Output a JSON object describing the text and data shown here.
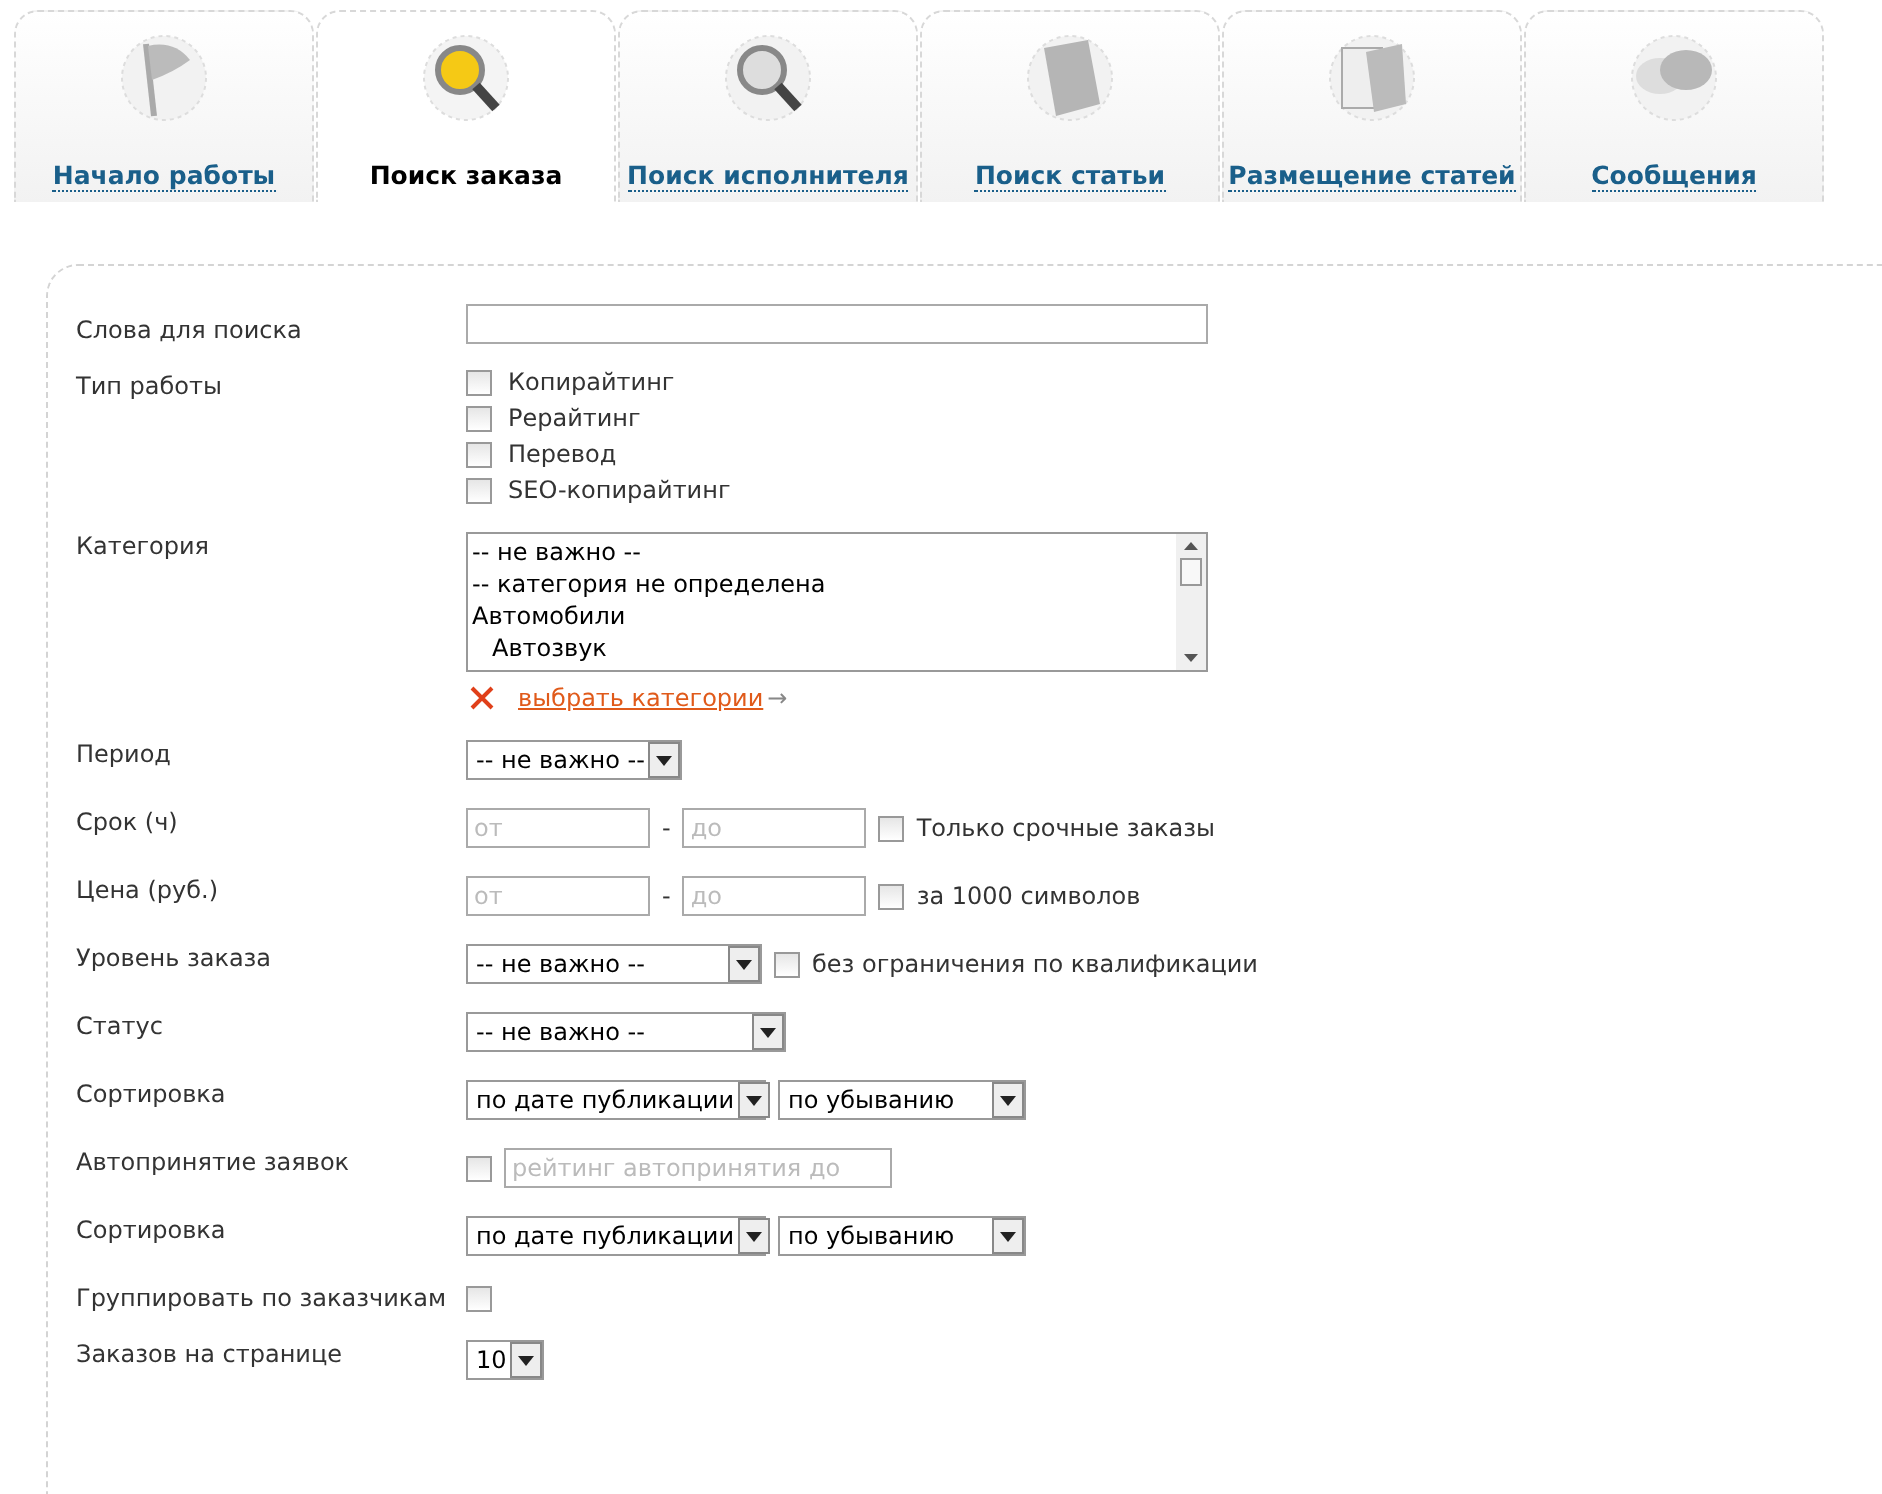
{
  "tabs": [
    {
      "label": "Начало работы",
      "selected": false
    },
    {
      "label": "Поиск заказа",
      "selected": true
    },
    {
      "label": "Поиск исполнителя",
      "selected": false
    },
    {
      "label": "Поиск статьи",
      "selected": false
    },
    {
      "label": "Размещение статей",
      "selected": false
    },
    {
      "label": "Сообщения",
      "selected": false
    }
  ],
  "form": {
    "rows": [
      {
        "kind": "text",
        "label": "Слова для поиска"
      },
      {
        "kind": "checkboxes",
        "label": "Тип работы",
        "options": [
          {
            "label": "Копирайтинг",
            "checked": false
          },
          {
            "label": "Рерайтинг",
            "checked": false
          },
          {
            "label": "Перевод",
            "checked": false
          },
          {
            "label": "SEO-копирайтинг",
            "checked": false
          }
        ]
      },
      {
        "kind": "listbox",
        "label": "Категория",
        "items": [
          {
            "label": "-- не важно --"
          },
          {
            "label": "-- категория не определена"
          },
          {
            "label": "Автомобили",
            "children": [
              {
                "label": "Автозвук"
              }
            ]
          }
        ],
        "link": "выбрать категории",
        "arrow": "→"
      },
      {
        "kind": "select",
        "label": "Период",
        "value": "-- не важно --"
      },
      {
        "kind": "range",
        "label": "Срок (ч)",
        "from": {
          "placeholder": "от"
        },
        "dash": "-",
        "to": {
          "placeholder": "до"
        },
        "check": {
          "label": "Только срочные заказы",
          "checked": false
        }
      },
      {
        "kind": "range",
        "label": "Цена (руб.)",
        "from": {
          "placeholder": "от"
        },
        "dash": "-",
        "to": {
          "placeholder": "до"
        },
        "check": {
          "label": "за 1000 символов",
          "checked": false
        }
      },
      {
        "kind": "select-check",
        "label": "Уровень заказа",
        "value": "-- не важно --",
        "check": {
          "label": "без ограничения по квалификации",
          "checked": false
        }
      },
      {
        "kind": "select-wide",
        "label": "Статус",
        "value": "-- не важно --"
      },
      {
        "kind": "selects",
        "label": "Сортировка",
        "values": [
          "по дате публикации",
          "по убыванию"
        ]
      },
      {
        "kind": "check-input",
        "label": "Автопринятие заявок",
        "checked": false,
        "placeholder": "рейтинг автопринятия до"
      },
      {
        "kind": "selects",
        "label": "Сортировка",
        "values": [
          "по дате публикации",
          "по убыванию"
        ]
      },
      {
        "kind": "check",
        "label": "Группировать по заказчикам",
        "checked": false
      },
      {
        "kind": "select",
        "label": "Заказов на странице",
        "value": "10"
      }
    ]
  }
}
